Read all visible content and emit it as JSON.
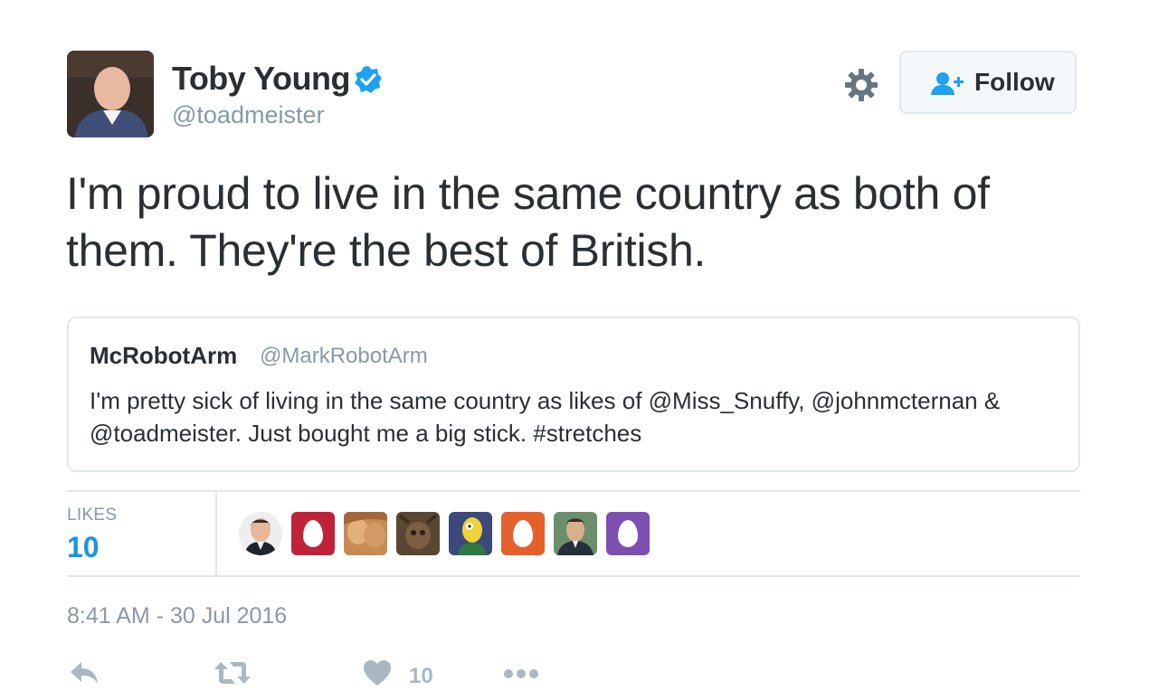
{
  "author": {
    "display_name": "Toby Young",
    "handle": "@toadmeister",
    "verified": true
  },
  "header": {
    "settings_icon": "gear-icon",
    "follow_label": "Follow",
    "follow_icon": "person-add-icon"
  },
  "tweet": {
    "text": "I'm proud to live in the same country as both of them. They're the best of British."
  },
  "quoted_tweet": {
    "display_name": "McRobotArm",
    "handle": "@MarkRobotArm",
    "text": "I'm pretty sick of living in the same country as likes of @Miss_Snuffy, @johnmcternan & @toadmeister. Just bought me a big stick. #stretches"
  },
  "stats": {
    "likes_label": "LIKES",
    "likes_count": "10",
    "likers": [
      "photo",
      "egg-red",
      "photo",
      "photo",
      "cartoon",
      "egg-orange",
      "photo",
      "egg-purple"
    ]
  },
  "timestamp": "8:41 AM - 30 Jul 2016",
  "actions": {
    "reply_icon": "reply-icon",
    "retweet_icon": "retweet-icon",
    "like_icon": "heart-icon",
    "like_count": "10",
    "more_icon": "more-dots-icon"
  },
  "colors": {
    "accent": "#1b95e0",
    "muted": "#8899a6",
    "border": "#e1e8ed",
    "action_gray": "#aab8c2",
    "verified": "#1da1f2",
    "follow_icon": "#1da1f2"
  }
}
